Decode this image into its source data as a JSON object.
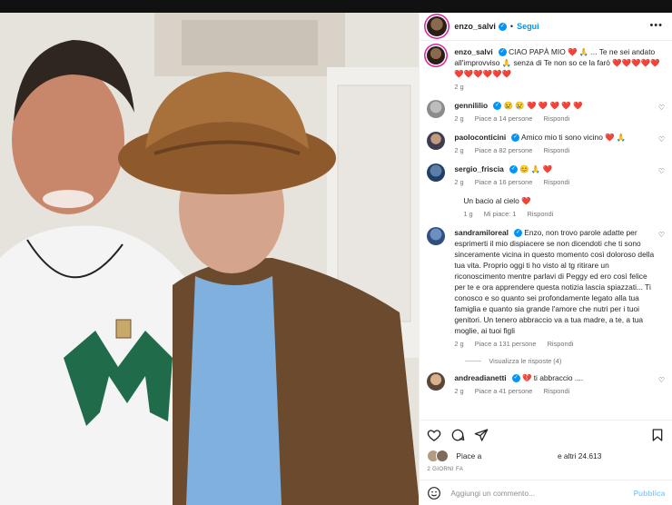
{
  "post": {
    "author": "enzo_salvi",
    "follow_label": "Segui",
    "dot": "•",
    "more": "•••"
  },
  "caption": {
    "author": "enzo_salvi",
    "text": "CIAO PAPÀ MIO ❤️ 🙏 ... Te ne sei andato all'improvviso 🙏 senza di Te non so ce la farò ❤️❤️❤️❤️❤️❤️❤️❤️❤️❤️❤️",
    "age": "2 g"
  },
  "comments": [
    {
      "author": "gennililio",
      "verified": true,
      "text": "😢 😢 ❤️ ❤️ ❤️ ❤️ ❤️",
      "age": "2 g",
      "likes": "Piace a 14 persone",
      "reply": "Rispondi"
    },
    {
      "author": "paoloconticini",
      "verified": true,
      "text": "Amico mio ti sono vicino ❤️ 🙏",
      "age": "2 g",
      "likes": "Piace a 82 persone",
      "reply": "Rispondi"
    },
    {
      "author": "sergio_friscia",
      "verified": true,
      "text": "😊 🙏 ❤️",
      "age": "2 g",
      "likes": "Piace a 16 persone",
      "reply": "Rispondi"
    },
    {
      "author": "",
      "verified": false,
      "text": "Un bacio al cielo ❤️",
      "age": "1 g",
      "likes": "Mi piace: 1",
      "reply": "Rispondi"
    },
    {
      "author": "sandramiloreal",
      "verified": true,
      "text": "Enzo, non trovo parole adatte per esprimerti il mio dispiacere se non dicendoti che ti sono sinceramente vicina in questo momento così doloroso della tua vita. Proprio oggi ti ho visto al tg ritirare un riconoscimento mentre parlavi di Peggy ed ero così felice per te e ora apprendere questa notizia lascia spiazzati... Ti conosco e so quanto sei profondamente legato alla tua famiglia e quanto sia grande l'amore che nutri per i tuoi genitori. Un tenero abbraccio va a tua madre, a te, a tua moglie, ai tuoi figli",
      "age": "2 g",
      "likes": "Piace a 131 persone",
      "reply": "Rispondi"
    },
    {
      "author": "andreadianetti",
      "verified": true,
      "text": "💔 ti abbraccio ....",
      "age": "2 g",
      "likes": "Piace a 41 persone",
      "reply": "Rispondi"
    }
  ],
  "view_replies": "Visualizza le risposte (4)",
  "actions": {
    "like_icon": "heart-icon",
    "comment_icon": "comment-icon",
    "share_icon": "paper-plane-icon",
    "save_icon": "bookmark-icon"
  },
  "likes_summary": {
    "prefix": "Piace a",
    "suffix": "e altri 24.613"
  },
  "post_date": "2 GIORNI FA",
  "add_comment": {
    "placeholder": "Aggiungi un commento...",
    "publish": "Pubblica"
  },
  "colors": {
    "accent": "#0095f6",
    "heart": "#ed1c24"
  }
}
